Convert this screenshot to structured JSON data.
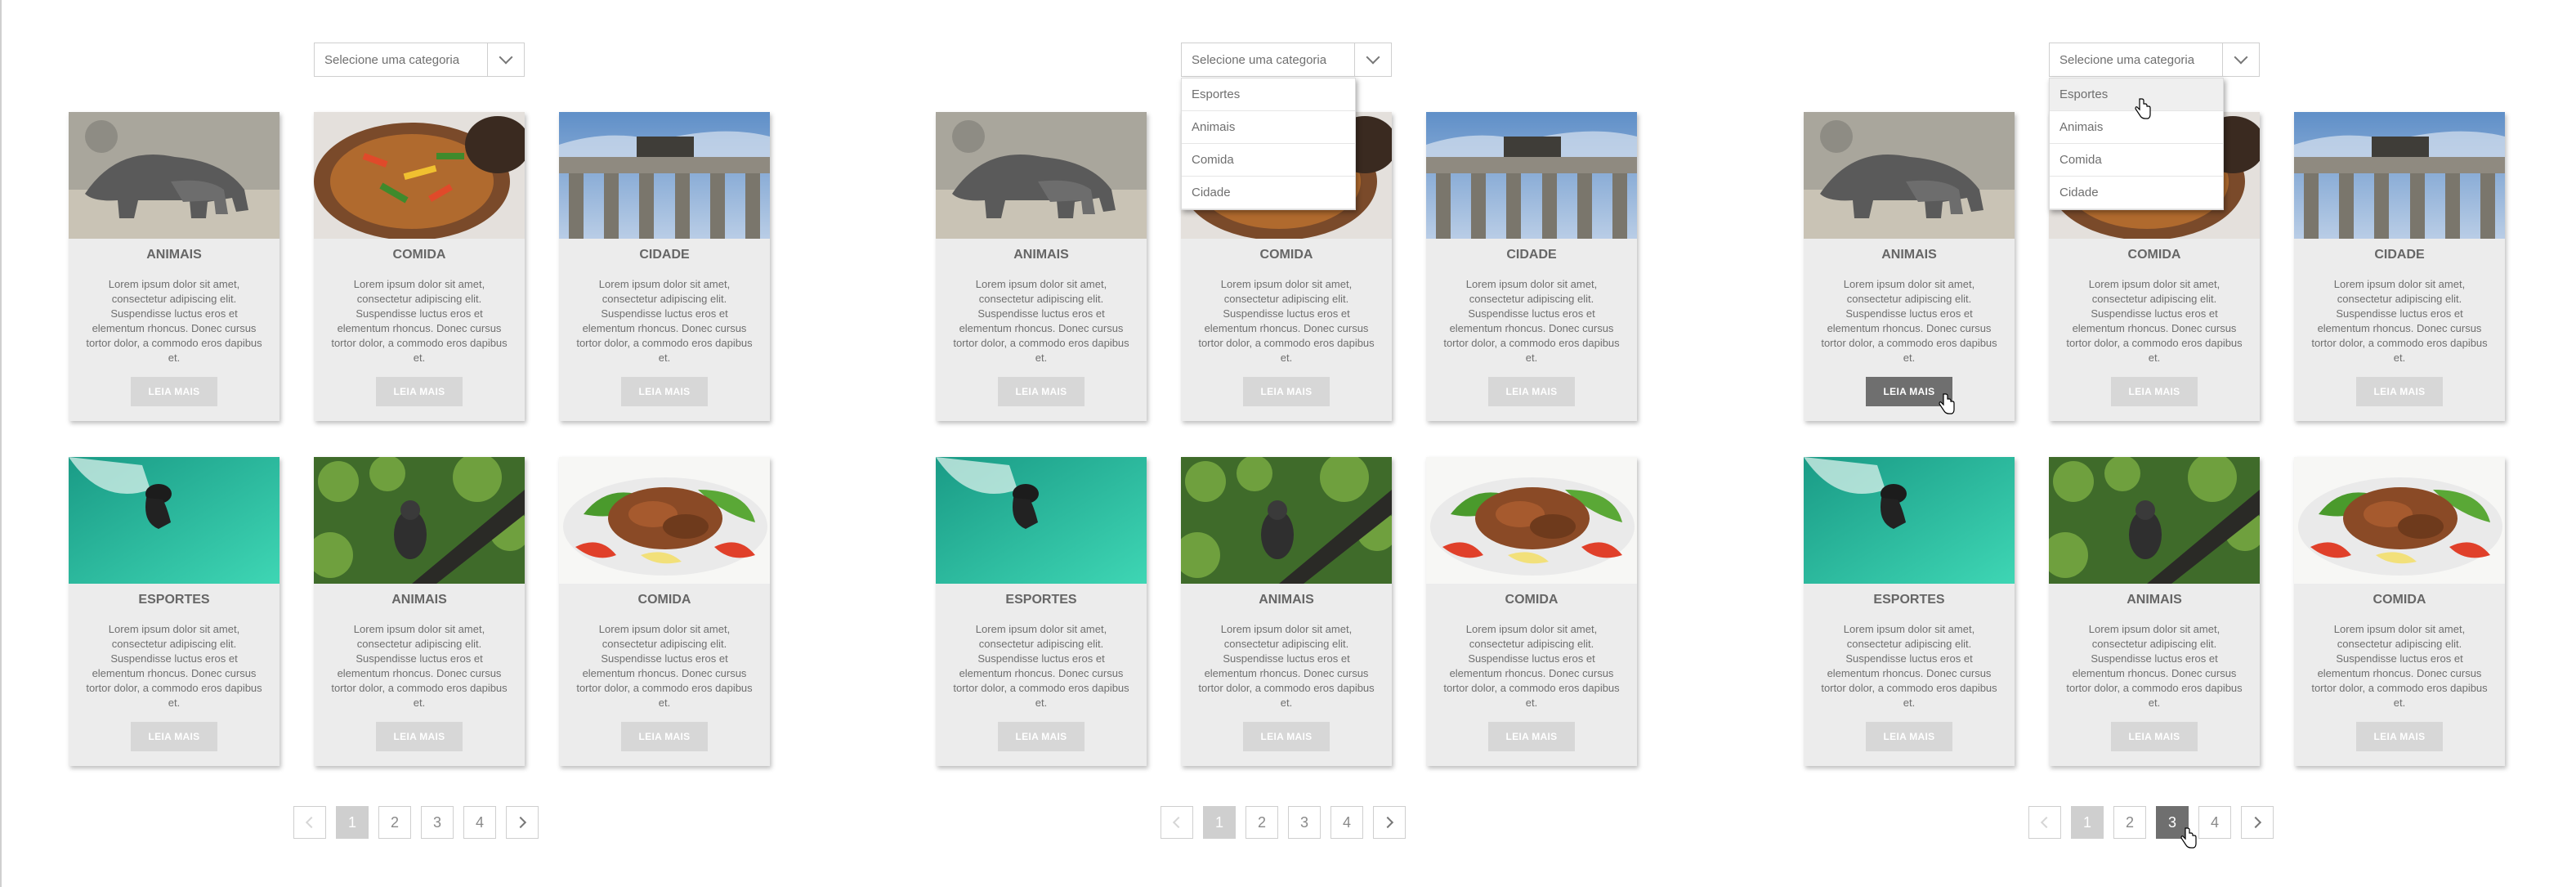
{
  "select": {
    "placeholder": "Selecione uma categoria"
  },
  "dropdown": {
    "options": [
      "Esportes",
      "Animais",
      "Comida",
      "Cidade"
    ]
  },
  "cards": [
    {
      "title": "ANIMAIS",
      "image": "rhino-photo"
    },
    {
      "title": "COMIDA",
      "image": "stew-photo"
    },
    {
      "title": "CIDADE",
      "image": "gate-photo"
    },
    {
      "title": "ESPORTES",
      "image": "diver-photo"
    },
    {
      "title": "ANIMAIS",
      "image": "gorilla-photo"
    },
    {
      "title": "COMIDA",
      "image": "steak-salad-photo"
    }
  ],
  "card_text": "Lorem ipsum dolor sit amet, consectetur adipiscing elit. Suspendisse luctus eros et elementum rhoncus. Donec cursus tortor dolor, a commodo eros dapibus et.",
  "button_label": "LEIA MAIS",
  "pagination": {
    "pages": [
      "1",
      "2",
      "3",
      "4"
    ]
  },
  "colors": {
    "panel": "#ffffff",
    "background": "#6b6b6b",
    "card": "#ececec",
    "button": "#d7d7d7",
    "button_active": "#6f6f6f"
  }
}
